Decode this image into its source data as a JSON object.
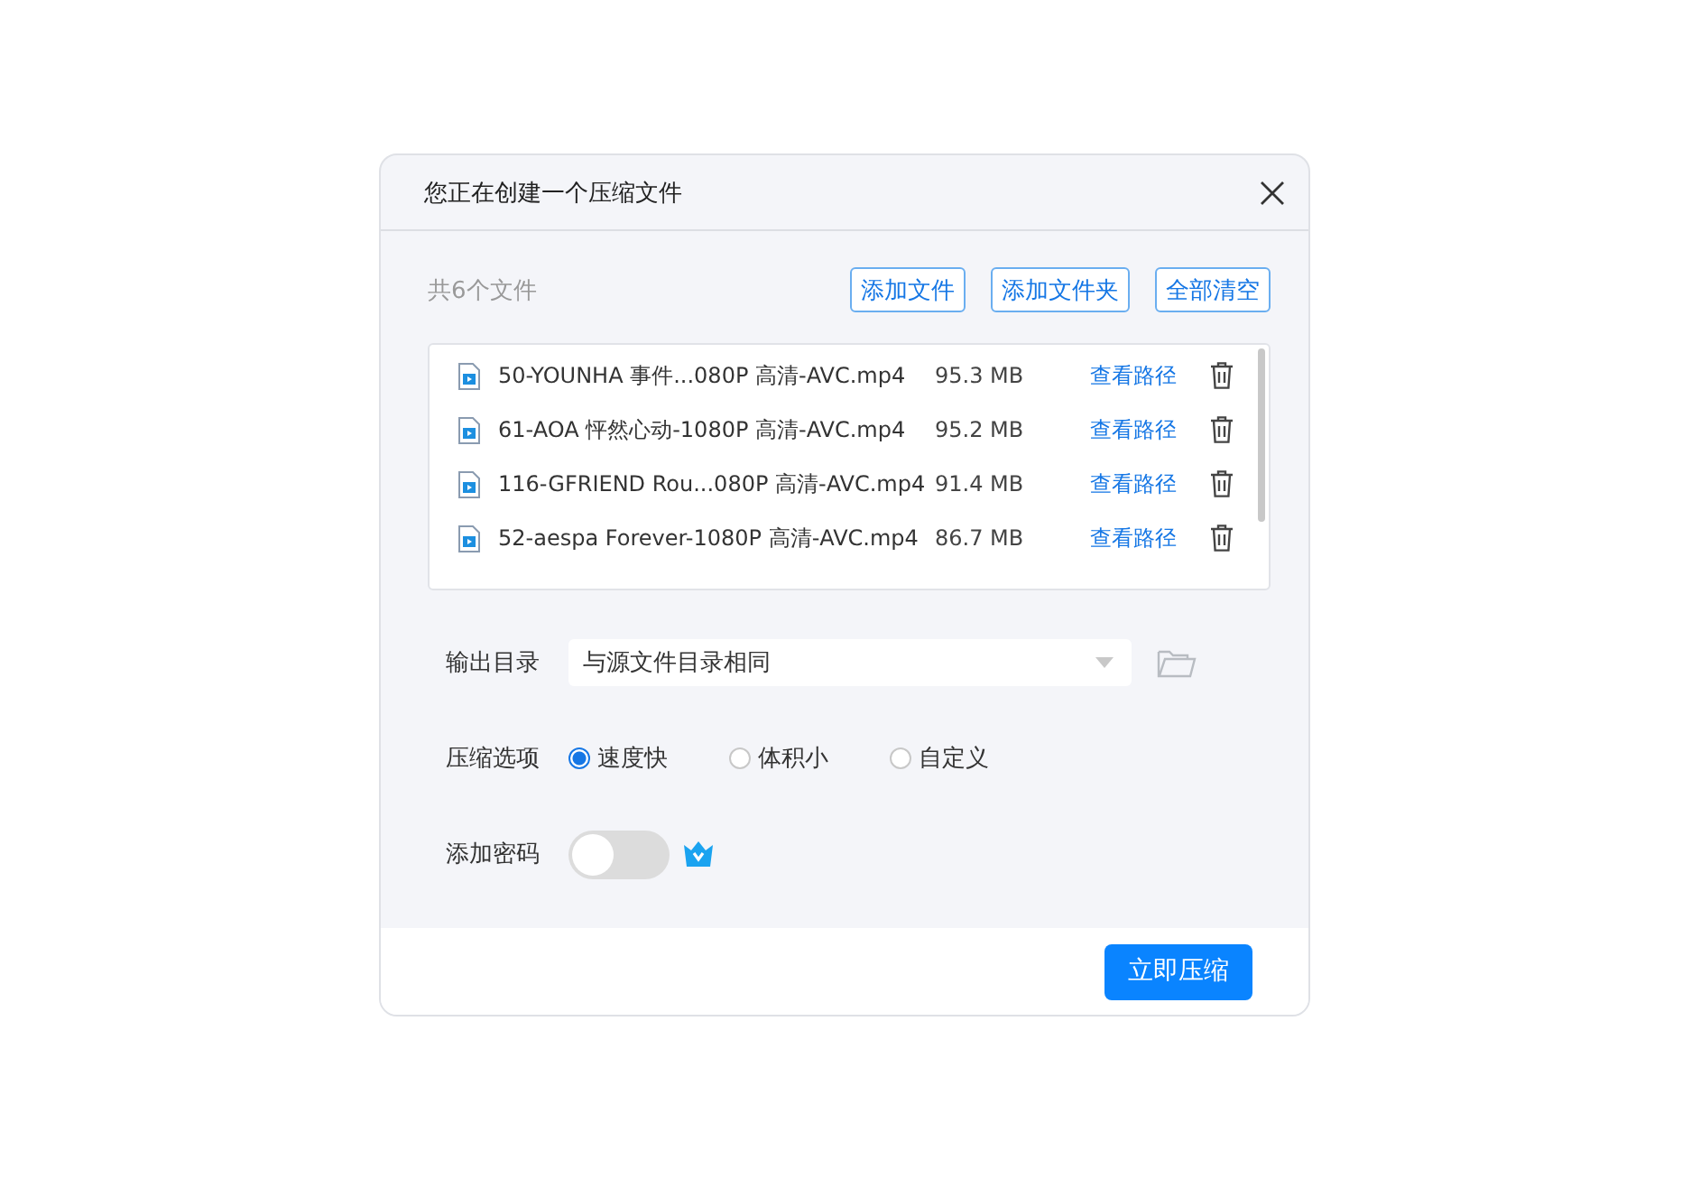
{
  "dialog": {
    "title": "您正在创建一个压缩文件"
  },
  "file_count": "共6个文件",
  "actions": [
    "添加文件",
    "添加文件夹",
    "全部清空"
  ],
  "files": [
    {
      "name": "50-YOUNHA 事件...080P 高清-AVC.mp4",
      "size": "95.3 MB",
      "link": "查看路径"
    },
    {
      "name": "61-AOA 怦然心动-1080P 高清-AVC.mp4",
      "size": "95.2 MB",
      "link": "查看路径"
    },
    {
      "name": "116-GFRIEND Rou...080P 高清-AVC.mp4",
      "size": "91.4 MB",
      "link": "查看路径"
    },
    {
      "name": "52-aespa Forever-1080P 高清-AVC.mp4",
      "size": "86.7 MB",
      "link": "查看路径"
    }
  ],
  "output": {
    "label": "输出目录",
    "value": "与源文件目录相同"
  },
  "compression": {
    "label": "压缩选项",
    "options": [
      {
        "label": "速度快",
        "selected": true
      },
      {
        "label": "体积小",
        "selected": false
      },
      {
        "label": "自定义",
        "selected": false
      }
    ]
  },
  "password": {
    "label": "添加密码",
    "on": false
  },
  "submit": "立即压缩"
}
